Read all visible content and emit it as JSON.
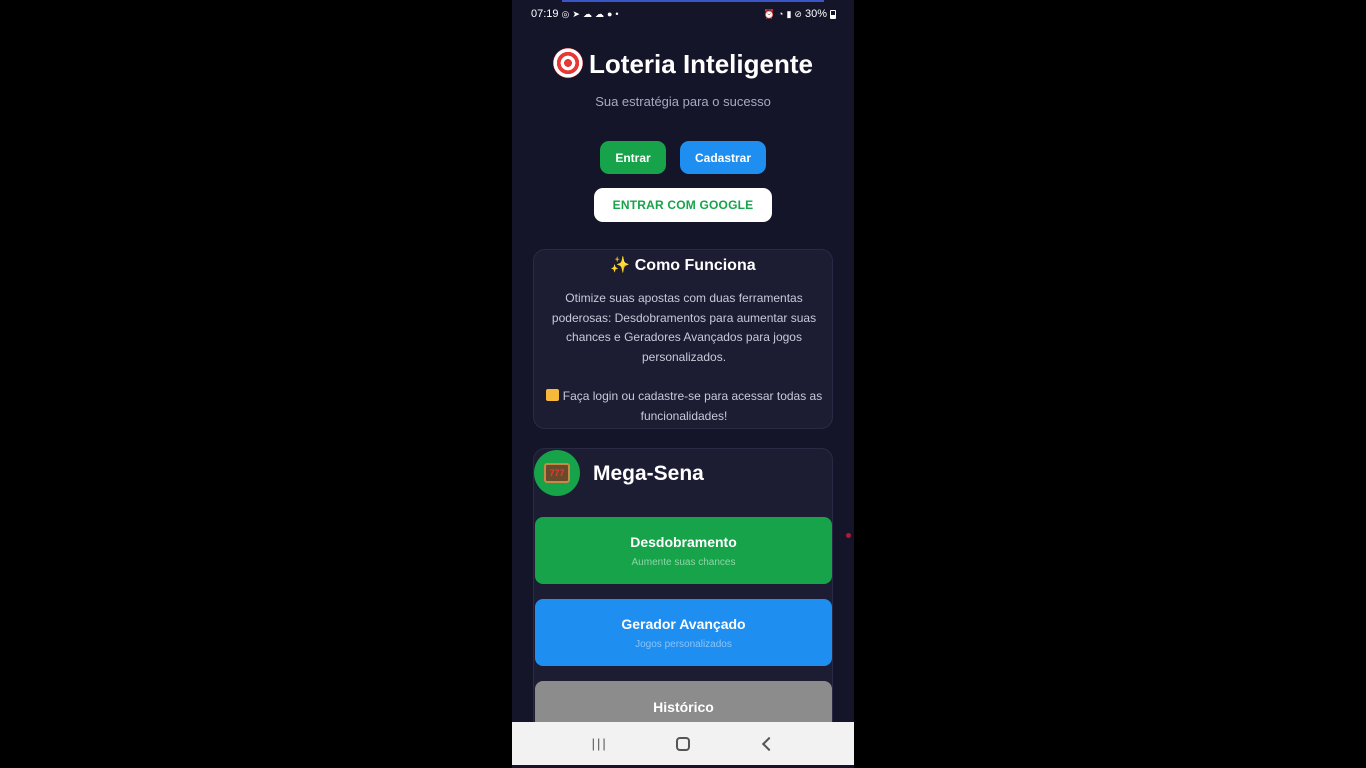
{
  "status_bar": {
    "time": "07:19",
    "left_icons": [
      "whatsapp-icon",
      "telegram-icon",
      "cloud-icon",
      "cloud-icon",
      "chat-icon",
      "dot-icon"
    ],
    "right_icons": [
      "alarm-icon",
      "wifi-icon",
      "signal-icon",
      "dnd-icon"
    ],
    "battery": "30%"
  },
  "app": {
    "title": "Loteria Inteligente",
    "subtitle": "Sua estratégia para o sucesso"
  },
  "auth": {
    "login_label": "Entrar",
    "signup_label": "Cadastrar",
    "google_label": "ENTRAR COM GOOGLE"
  },
  "how_it_works": {
    "title": "✨ Como Funciona",
    "description": "Otimize suas apostas com duas ferramentas poderosas: Desdobramentos para aumentar suas chances e Geradores Avançados para jogos personalizados.",
    "cta": "Faça login ou cadastre-se para acessar todas as funcionalidades!"
  },
  "mega_sena": {
    "title": "Mega-Sena",
    "slot_text": "777",
    "features": [
      {
        "title": "Desdobramento",
        "subtitle": "Aumente suas chances"
      },
      {
        "title": "Gerador Avançado",
        "subtitle": "Jogos personalizados"
      },
      {
        "title": "Histórico",
        "subtitle": ""
      }
    ]
  },
  "nav_bar": {
    "recents_glyph": "|||"
  },
  "colors": {
    "background": "#15152a",
    "green": "#16a34a",
    "blue": "#1f8ef1",
    "gray": "#8c8c8c"
  }
}
